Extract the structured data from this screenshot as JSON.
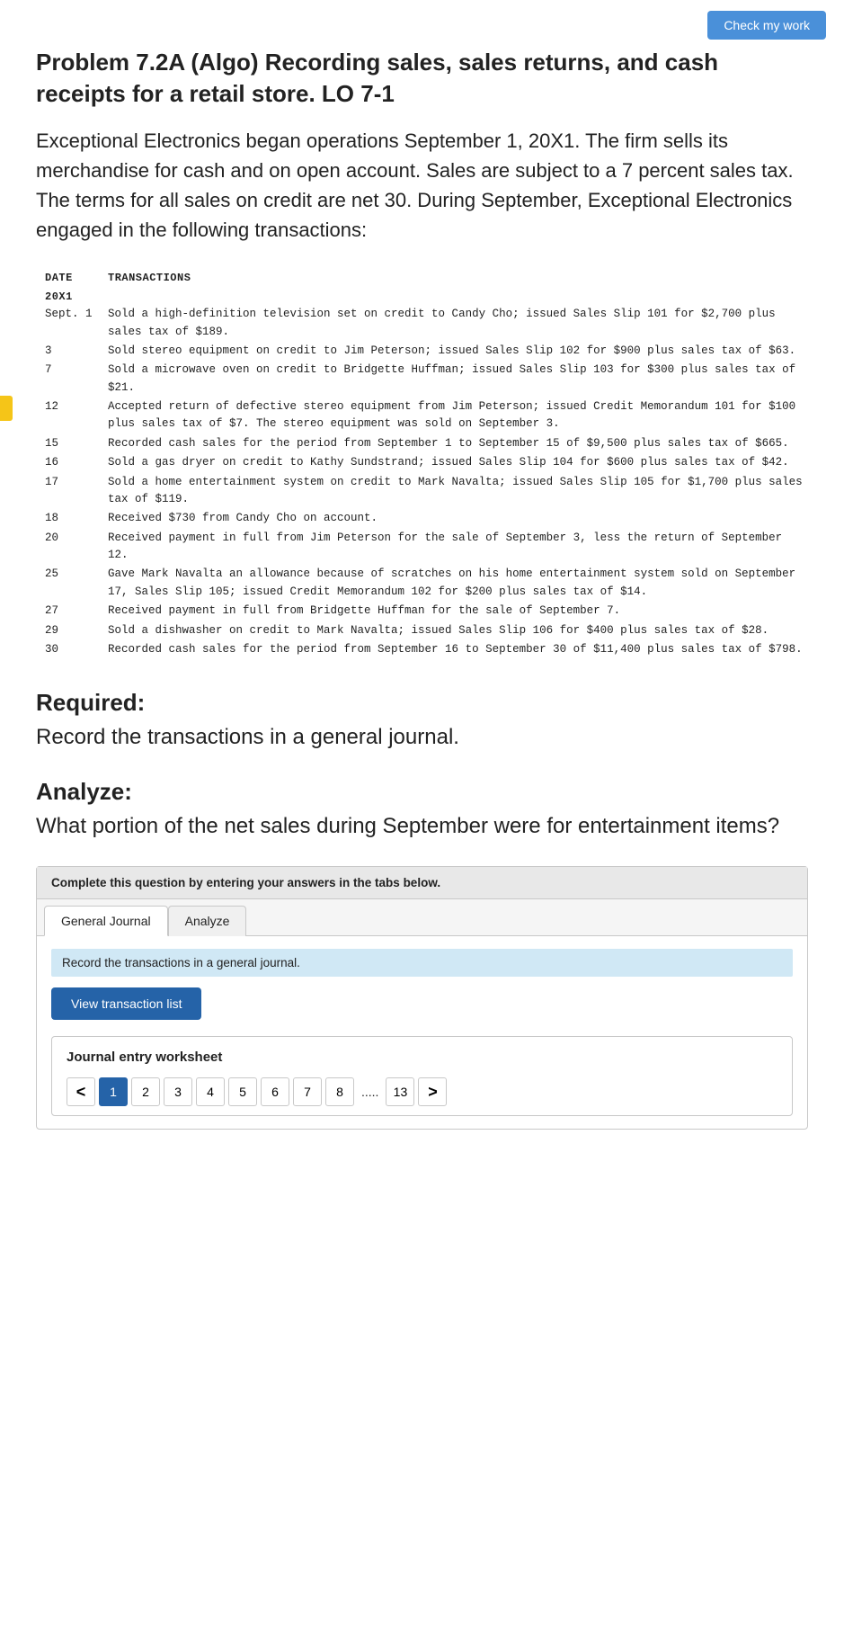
{
  "header": {
    "check_my_work_label": "Check my work"
  },
  "problem": {
    "title": "Problem 7.2A (Algo) Recording sales, sales returns, and cash receipts for a retail store. LO 7-1",
    "description": "Exceptional Electronics began operations September 1, 20X1. The firm sells its merchandise for cash and on open account. Sales are subject to a 7 percent sales tax. The terms for all sales on credit are net 30. During September, Exceptional Electronics engaged in the following transactions:"
  },
  "transactions_table": {
    "date_header": "DATE",
    "trans_header": "TRANSACTIONS",
    "year": "20X1",
    "rows": [
      {
        "date": "Sept. 1",
        "text": "Sold a high-definition television set on credit to Candy Cho; issued Sales Slip 101 for $2,700 plus sales tax of $189."
      },
      {
        "date": "3",
        "text": "Sold stereo equipment on credit to Jim Peterson; issued Sales Slip 102 for $900 plus sales tax of $63."
      },
      {
        "date": "7",
        "text": "Sold a microwave oven on credit to Bridgette Huffman; issued Sales Slip 103 for $300 plus sales tax of $21."
      },
      {
        "date": "12",
        "text": "Accepted return of defective stereo equipment from Jim Peterson; issued Credit Memorandum 101 for $100 plus sales tax of $7. The stereo equipment was sold on September 3."
      },
      {
        "date": "15",
        "text": "Recorded cash sales for the period from September 1 to September 15 of $9,500 plus sales tax of $665."
      },
      {
        "date": "16",
        "text": "Sold a gas dryer on credit to Kathy Sundstrand; issued Sales Slip 104 for $600 plus sales tax of $42."
      },
      {
        "date": "17",
        "text": "Sold a home entertainment system on credit to Mark Navalta; issued Sales Slip 105 for $1,700 plus sales tax of $119."
      },
      {
        "date": "18",
        "text": "Received $730 from Candy Cho on account."
      },
      {
        "date": "20",
        "text": "Received payment in full from Jim Peterson for the sale of September 3, less the return of September 12."
      },
      {
        "date": "25",
        "text": "Gave Mark Navalta an allowance because of scratches on his home entertainment system sold on September 17, Sales Slip 105; issued Credit Memorandum 102 for $200 plus sales tax of $14."
      },
      {
        "date": "27",
        "text": "Received payment in full from Bridgette Huffman for the sale of September 7."
      },
      {
        "date": "29",
        "text": "Sold a dishwasher on credit to Mark Navalta; issued Sales Slip 106 for $400 plus sales tax of $28."
      },
      {
        "date": "30",
        "text": "Recorded cash sales for the period from September 16 to September 30 of $11,400 plus sales tax of $798."
      }
    ]
  },
  "required_section": {
    "heading": "Required:",
    "body": "Record the transactions in a general journal."
  },
  "analyze_section": {
    "heading": "Analyze:",
    "body": "What portion of the net sales during September were for entertainment items?"
  },
  "tabs_area": {
    "instruction": "Complete this question by entering your answers in the tabs below.",
    "tab1_label": "General Journal",
    "tab2_label": "Analyze",
    "record_text": "Record the transactions in a general journal.",
    "view_transaction_btn": "View transaction list",
    "journal_entry_title": "Journal entry worksheet",
    "pages": [
      "<",
      "1",
      "2",
      "3",
      "4",
      "5",
      "6",
      "7",
      "8",
      ".....",
      "13",
      ">"
    ]
  }
}
